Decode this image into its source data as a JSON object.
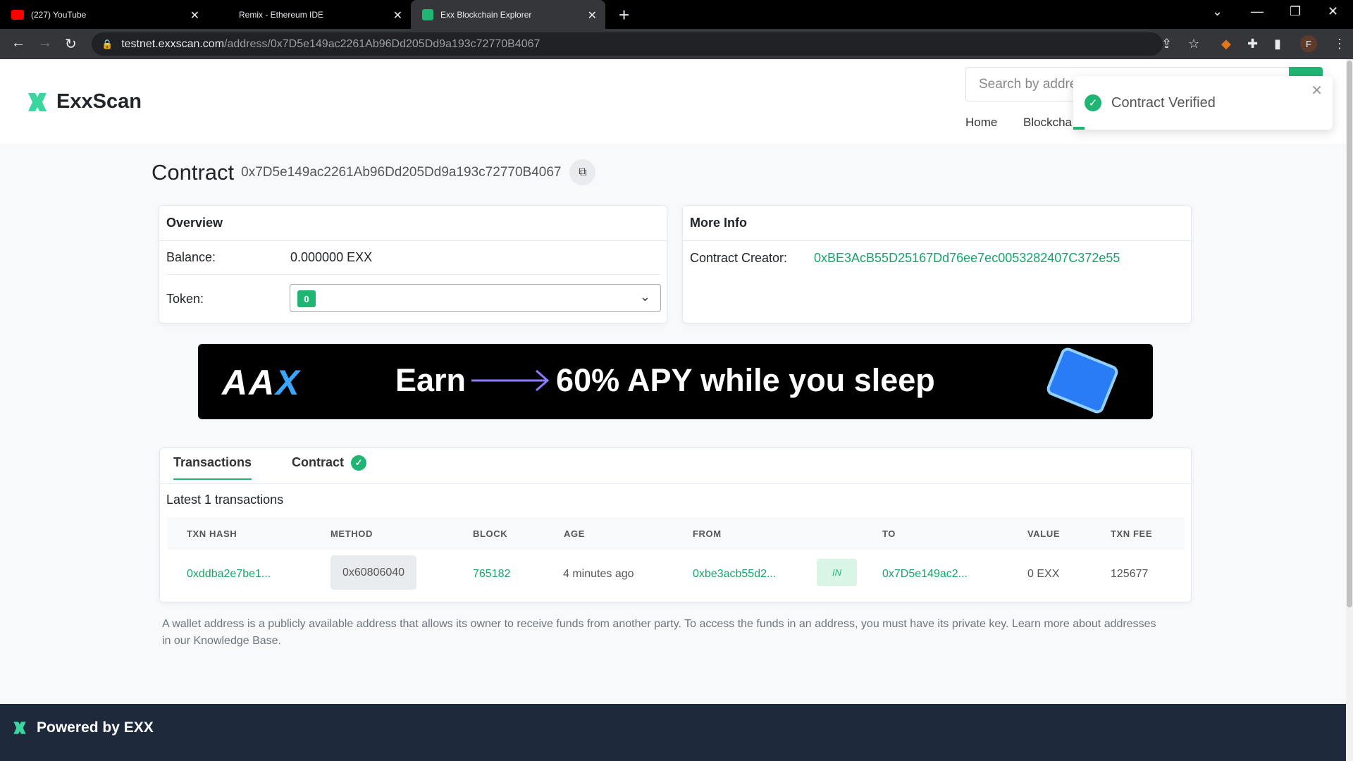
{
  "browser": {
    "tabs": [
      {
        "title": "(227) YouTube"
      },
      {
        "title": "Remix - Ethereum IDE"
      },
      {
        "title": "Exx Blockchain Explorer"
      }
    ],
    "url_host": "testnet.exxscan.com",
    "url_path": "/address/0x7D5e149ac2261Ab96Dd205Dd9a193c72770B4067",
    "profile_initial": "F"
  },
  "header": {
    "logo_text": "ExxScan",
    "search_placeholder": "Search by addre",
    "nav": {
      "home": "Home",
      "blockchain": "Blockcha"
    }
  },
  "toast": {
    "message": "Contract Verified"
  },
  "contract": {
    "label": "Contract",
    "address": "0x7D5e149ac2261Ab96Dd205Dd9a193c72770B4067"
  },
  "overview": {
    "title": "Overview",
    "balance_label": "Balance:",
    "balance_value": "0.000000 EXX",
    "token_label": "Token:",
    "token_count": "0"
  },
  "more_info": {
    "title": "More Info",
    "creator_label": "Contract Creator:",
    "creator_value": "0xBE3AcB55D25167Dd76ee7ec0053282407C372e55"
  },
  "ad": {
    "brand_a": "AA",
    "brand_x": "X",
    "earn": "Earn",
    "slogan": "60% APY while you sleep"
  },
  "tabs": {
    "transactions": "Transactions",
    "contract": "Contract"
  },
  "transactions": {
    "summary": "Latest 1 transactions",
    "columns": [
      "TXN HASH",
      "METHOD",
      "BLOCK",
      "AGE",
      "FROM",
      "TO",
      "VALUE",
      "TXN FEE"
    ],
    "rows": [
      {
        "hash": "0xddba2e7be1...",
        "method": "0x60806040",
        "block": "765182",
        "age": "4 minutes ago",
        "from": "0xbe3acb55d2...",
        "direction": "IN",
        "to": "0x7D5e149ac2...",
        "value": "0 EXX",
        "fee": "125677"
      }
    ]
  },
  "description": "A wallet address is a publicly available address that allows its owner to receive funds from another party. To access the funds in an address, you must have its private key. Learn more about addresses in our Knowledge Base.",
  "footer": {
    "text": "Powered by EXX"
  },
  "colors": {
    "accent": "#21b573",
    "link": "#1aa36a",
    "footer_bg": "#1e2a3c"
  }
}
